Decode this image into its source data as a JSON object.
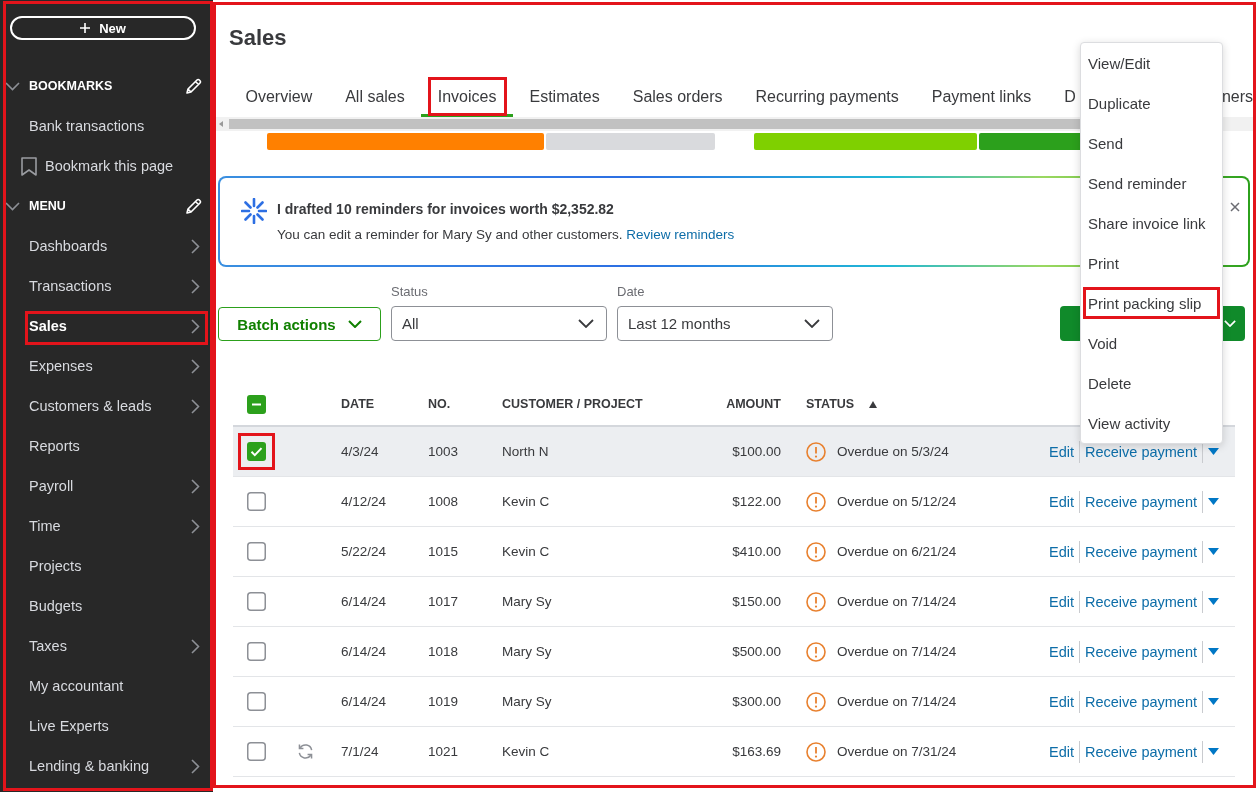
{
  "sidebar": {
    "highlighted": true,
    "new_button": {
      "label": "New"
    },
    "sections": [
      {
        "title": "BOOKMARKS",
        "expanded": true,
        "editable": true,
        "items": [
          {
            "label": "Bank transactions",
            "kind": "link",
            "submenu": false,
            "selected": false,
            "highlighted": false
          },
          {
            "label": "Bookmark this page",
            "kind": "bookmark",
            "submenu": false,
            "selected": false,
            "highlighted": false
          }
        ]
      },
      {
        "title": "MENU",
        "expanded": true,
        "editable": true,
        "items": [
          {
            "label": "Dashboards",
            "kind": "link",
            "submenu": true,
            "selected": false,
            "highlighted": false
          },
          {
            "label": "Transactions",
            "kind": "link",
            "submenu": true,
            "selected": false,
            "highlighted": false
          },
          {
            "label": "Sales",
            "kind": "link",
            "submenu": true,
            "selected": true,
            "highlighted": true
          },
          {
            "label": "Expenses",
            "kind": "link",
            "submenu": true,
            "selected": false,
            "highlighted": false
          },
          {
            "label": "Customers & leads",
            "kind": "link",
            "submenu": true,
            "selected": false,
            "highlighted": false
          },
          {
            "label": "Reports",
            "kind": "link",
            "submenu": false,
            "selected": false,
            "highlighted": false
          },
          {
            "label": "Payroll",
            "kind": "link",
            "submenu": true,
            "selected": false,
            "highlighted": false
          },
          {
            "label": "Time",
            "kind": "link",
            "submenu": true,
            "selected": false,
            "highlighted": false
          },
          {
            "label": "Projects",
            "kind": "link",
            "submenu": false,
            "selected": false,
            "highlighted": false
          },
          {
            "label": "Budgets",
            "kind": "link",
            "submenu": false,
            "selected": false,
            "highlighted": false
          },
          {
            "label": "Taxes",
            "kind": "link",
            "submenu": true,
            "selected": false,
            "highlighted": false
          },
          {
            "label": "My accountant",
            "kind": "link",
            "submenu": false,
            "selected": false,
            "highlighted": false
          },
          {
            "label": "Live Experts",
            "kind": "link",
            "submenu": false,
            "selected": false,
            "highlighted": false
          },
          {
            "label": "Lending & banking",
            "kind": "link",
            "submenu": true,
            "selected": false,
            "highlighted": false
          }
        ]
      }
    ]
  },
  "main": {
    "highlighted": true,
    "title": "Sales",
    "tabs": [
      {
        "label": "Overview",
        "selected": false,
        "highlighted": false
      },
      {
        "label": "All sales",
        "selected": false,
        "highlighted": false
      },
      {
        "label": "Invoices",
        "selected": true,
        "highlighted": true
      },
      {
        "label": "Estimates",
        "selected": false,
        "highlighted": false
      },
      {
        "label": "Sales orders",
        "selected": false,
        "highlighted": false
      },
      {
        "label": "Recurring payments",
        "selected": false,
        "highlighted": false
      },
      {
        "label": "Payment links",
        "selected": false,
        "highlighted": false
      },
      {
        "label": "D",
        "selected": false,
        "highlighted": false
      },
      {
        "label": "ners",
        "selected": false,
        "highlighted": false
      }
    ],
    "banner": {
      "title": "I drafted 10 reminders for invoices worth $2,352.82",
      "text": "You can edit a reminder for Mary Sy and other customers.",
      "link": "Review reminders",
      "dismissible": true
    },
    "filters": {
      "batch_actions": "Batch actions",
      "status": {
        "label": "Status",
        "value": "All"
      },
      "date": {
        "label": "Date",
        "value": "Last 12 months"
      }
    },
    "table": {
      "select_all": {
        "checked": false,
        "indeterminate": true
      },
      "columns": [
        {
          "label": "DATE",
          "sorted_ascending": false
        },
        {
          "label": "NO.",
          "sorted_ascending": false
        },
        {
          "label": "CUSTOMER / PROJECT",
          "sorted_ascending": false
        },
        {
          "label": "AMOUNT",
          "sorted_ascending": false
        },
        {
          "label": "STATUS",
          "sorted_ascending": true
        }
      ],
      "rows": [
        {
          "selected": true,
          "highlighted": true,
          "recurring": false,
          "date": "4/3/24",
          "no": "1003",
          "customer": "North N",
          "amount": "$100.00",
          "status": {
            "kind": "overdue",
            "text": "Overdue on 5/3/24"
          },
          "edit": "Edit",
          "action": "Receive payment"
        },
        {
          "selected": false,
          "highlighted": false,
          "recurring": false,
          "date": "4/12/24",
          "no": "1008",
          "customer": "Kevin C",
          "amount": "$122.00",
          "status": {
            "kind": "overdue",
            "text": "Overdue on 5/12/24"
          },
          "edit": "Edit",
          "action": "Receive payment"
        },
        {
          "selected": false,
          "highlighted": false,
          "recurring": false,
          "date": "5/22/24",
          "no": "1015",
          "customer": "Kevin C",
          "amount": "$410.00",
          "status": {
            "kind": "overdue",
            "text": "Overdue on 6/21/24"
          },
          "edit": "Edit",
          "action": "Receive payment"
        },
        {
          "selected": false,
          "highlighted": false,
          "recurring": false,
          "date": "6/14/24",
          "no": "1017",
          "customer": "Mary Sy",
          "amount": "$150.00",
          "status": {
            "kind": "overdue",
            "text": "Overdue on 7/14/24"
          },
          "edit": "Edit",
          "action": "Receive payment"
        },
        {
          "selected": false,
          "highlighted": false,
          "recurring": false,
          "date": "6/14/24",
          "no": "1018",
          "customer": "Mary Sy",
          "amount": "$500.00",
          "status": {
            "kind": "overdue",
            "text": "Overdue on 7/14/24"
          },
          "edit": "Edit",
          "action": "Receive payment"
        },
        {
          "selected": false,
          "highlighted": false,
          "recurring": false,
          "date": "6/14/24",
          "no": "1019",
          "customer": "Mary Sy",
          "amount": "$300.00",
          "status": {
            "kind": "overdue",
            "text": "Overdue on 7/14/24"
          },
          "edit": "Edit",
          "action": "Receive payment"
        },
        {
          "selected": false,
          "highlighted": false,
          "recurring": true,
          "date": "7/1/24",
          "no": "1021",
          "customer": "Kevin C",
          "amount": "$163.69",
          "status": {
            "kind": "overdue",
            "text": "Overdue on 7/31/24"
          },
          "edit": "Edit",
          "action": "Receive payment"
        }
      ]
    },
    "row_menu": {
      "open": true,
      "items": [
        {
          "label": "View/Edit",
          "highlighted": false
        },
        {
          "label": "Duplicate",
          "highlighted": false
        },
        {
          "label": "Send",
          "highlighted": false
        },
        {
          "label": "Send reminder",
          "highlighted": false
        },
        {
          "label": "Share invoice link",
          "highlighted": false
        },
        {
          "label": "Print",
          "highlighted": false
        },
        {
          "label": "Print packing slip",
          "highlighted": true
        },
        {
          "label": "Void",
          "highlighted": false
        },
        {
          "label": "Delete",
          "highlighted": false
        },
        {
          "label": "View activity",
          "highlighted": false
        }
      ]
    }
  }
}
